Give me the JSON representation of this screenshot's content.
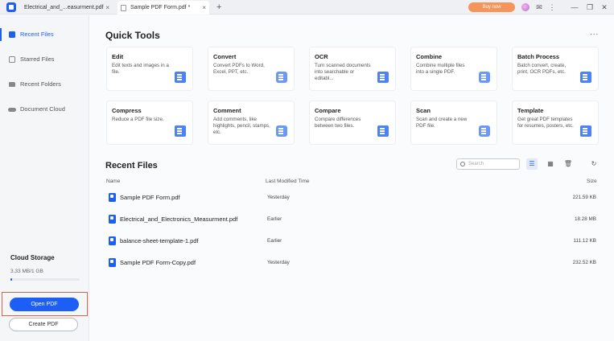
{
  "titlebar": {
    "tabs": [
      {
        "label": "Electrical_and_...easurment.pdf",
        "close": "×"
      },
      {
        "label": "Sample PDF Form.pdf *",
        "close": "×"
      }
    ],
    "new_tab": "+",
    "buy_now": "Buy now",
    "icons": {
      "mail": "✉",
      "menu": "⋮",
      "minimize": "—",
      "restore": "❐",
      "close": "✕"
    }
  },
  "sidebar": {
    "items": [
      {
        "label": "Recent Files",
        "icon": "recent-files-icon"
      },
      {
        "label": "Starred Files",
        "icon": "star-icon"
      },
      {
        "label": "Recent Folders",
        "icon": "folder-icon"
      },
      {
        "label": "Document Cloud",
        "icon": "cloud-icon"
      }
    ],
    "cloud_storage_title": "Cloud Storage",
    "cloud_storage_usage": "3.33 MB/1 GB",
    "cloud_storage_fraction": 0.003,
    "open_pdf": "Open PDF",
    "create_pdf": "Create PDF"
  },
  "quick_tools": {
    "title": "Quick Tools",
    "more": "...",
    "cards": [
      {
        "title": "Edit",
        "desc": "Edit texts and images in a file."
      },
      {
        "title": "Convert",
        "desc": "Convert PDFs to Word, Excel, PPT, etc."
      },
      {
        "title": "OCR",
        "desc": "Turn scanned documents into searchable or editabl..."
      },
      {
        "title": "Combine",
        "desc": "Combine multiple files into a single PDF."
      },
      {
        "title": "Batch Process",
        "desc": "Batch convert, create, print, OCR PDFs, etc."
      },
      {
        "title": "Compress",
        "desc": "Reduce a PDF file size."
      },
      {
        "title": "Comment",
        "desc": "Add comments, like highlights, pencil, stamps, etc."
      },
      {
        "title": "Compare",
        "desc": "Compare differences between two files."
      },
      {
        "title": "Scan",
        "desc": "Scan and create a new PDF file."
      },
      {
        "title": "Template",
        "desc": "Get great PDF templates for resumes, posters, etc."
      }
    ]
  },
  "recent": {
    "title": "Recent Files",
    "search_placeholder": "Search",
    "columns": {
      "name": "Name",
      "time": "Last Modified Time",
      "size": "Size"
    },
    "files": [
      {
        "name": "Sample PDF Form.pdf",
        "time": "Yesterday",
        "size": "221.59 KB"
      },
      {
        "name": "Electrical_and_Electronics_Measurment.pdf",
        "time": "Earlier",
        "size": "18.28 MB"
      },
      {
        "name": "balance-sheet-template-1.pdf",
        "time": "Earlier",
        "size": "111.12 KB"
      },
      {
        "name": "Sample PDF Form-Copy.pdf",
        "time": "Yesterday",
        "size": "232.52 KB"
      }
    ],
    "view_icons": {
      "list": "☰",
      "grid": "▦",
      "trash": "🗑",
      "refresh": "↻"
    }
  },
  "colors": {
    "accent": "#1d5ff5",
    "buy_now": "#f6955a",
    "highlight_border": "#d9634a"
  }
}
